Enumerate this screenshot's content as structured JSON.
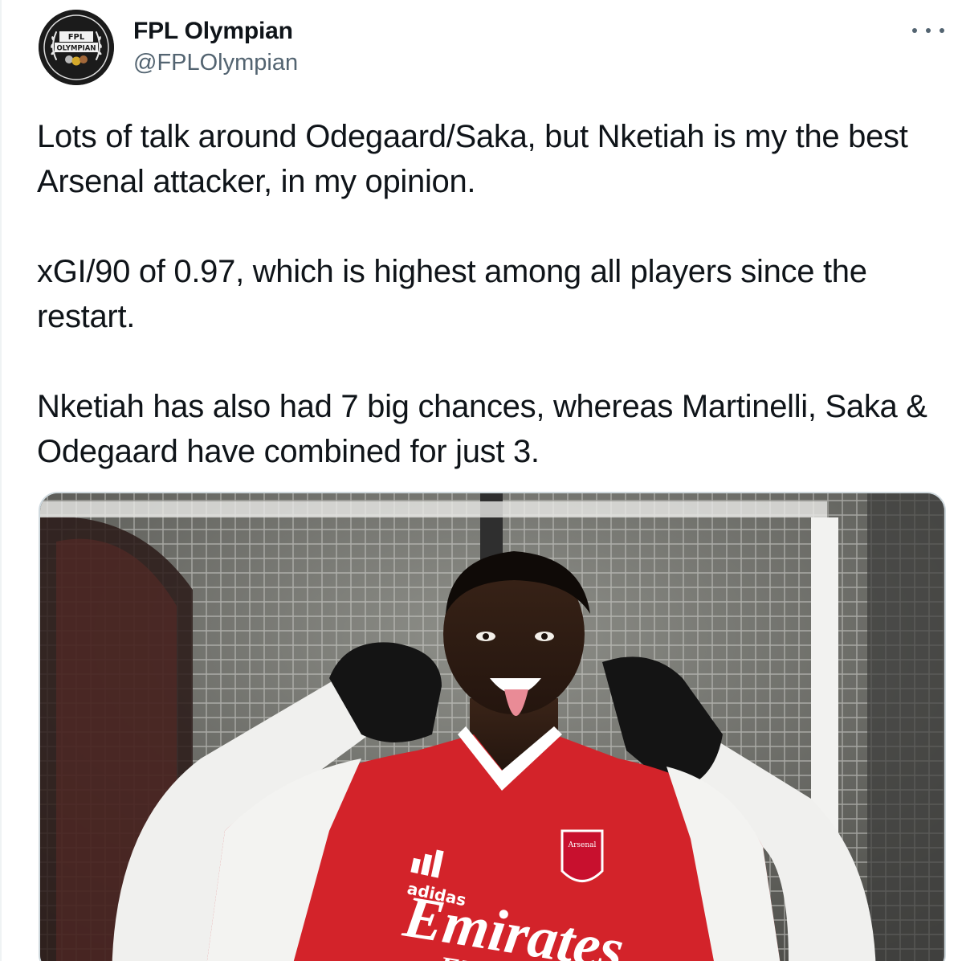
{
  "author": {
    "display_name": "FPL Olympian",
    "handle": "@FPLOlympian",
    "avatar_text_top": "FPL",
    "avatar_text_bottom": "OLYMPIAN"
  },
  "tweet": {
    "paragraphs": [
      "Lots of talk around Odegaard/Saka, but Nketiah is my the best Arsenal attacker, in my opinion.",
      "xGI/90 of 0.97, which is highest among all players since the restart.",
      "Nketiah has also had 7 big chances, whereas Martinelli, Saka & Odegaard have combined for just 3."
    ]
  },
  "media": {
    "shirt_brand": "adidas",
    "shirt_sponsor": "Emirates",
    "shirt_tagline": "FLY BETTER",
    "crest_text": "Arsenal"
  },
  "icons": {
    "more": "more-horizontal-icon"
  },
  "colors": {
    "text": "#0f1419",
    "secondary_text": "#536471",
    "border": "#cfd9de",
    "shirt_red": "#d3232a"
  }
}
